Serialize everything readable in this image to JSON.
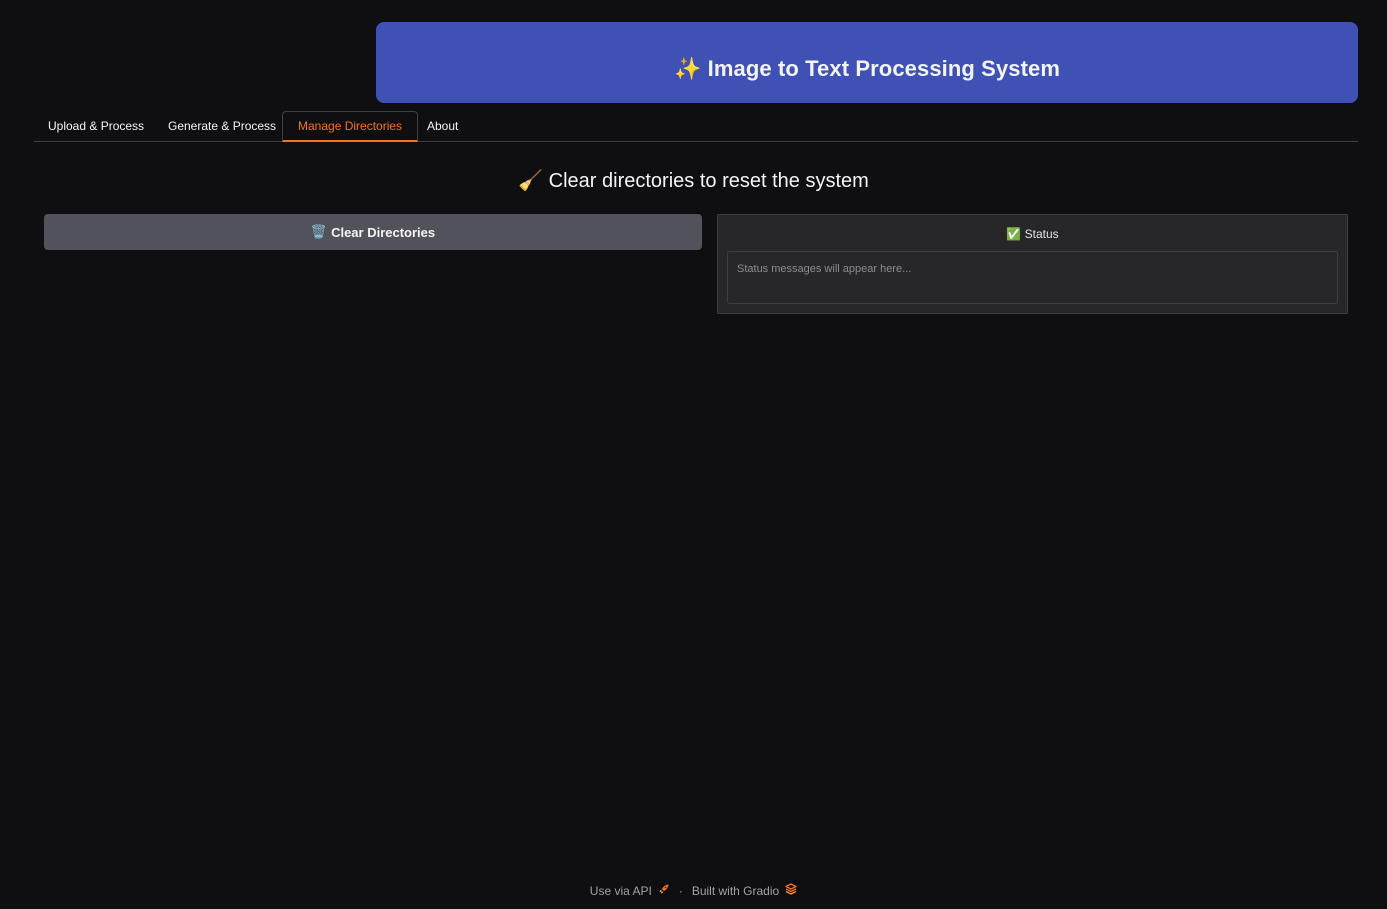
{
  "header": {
    "icon": "sparkles-icon",
    "title_emoji": "✨",
    "title": "Image to Text Processing System",
    "banner_color": "#3f51b5"
  },
  "tabs": [
    {
      "label": "Upload & Process",
      "active": false
    },
    {
      "label": "Generate & Process",
      "active": false
    },
    {
      "label": "Manage Directories",
      "active": true
    },
    {
      "label": "About",
      "active": false
    }
  ],
  "main": {
    "heading_emoji": "🧹",
    "heading_icon": "broom-icon",
    "heading": "Clear directories to reset the system",
    "clear_button": {
      "emoji": "🗑️",
      "icon": "wastebasket-icon",
      "label": "Clear Directories"
    },
    "status": {
      "emoji": "✅",
      "icon": "check-mark-icon",
      "label": "Status",
      "value": "",
      "placeholder": "Status messages will appear here..."
    }
  },
  "footer": {
    "api_label": "Use via API",
    "api_icon": "rocket-icon",
    "separator": "·",
    "built_label": "Built with Gradio",
    "built_icon": "gradio-logo-icon"
  },
  "colors": {
    "background": "#0f0f11",
    "accent": "#f97316",
    "button": "#52525b",
    "panel": "#27272a"
  }
}
